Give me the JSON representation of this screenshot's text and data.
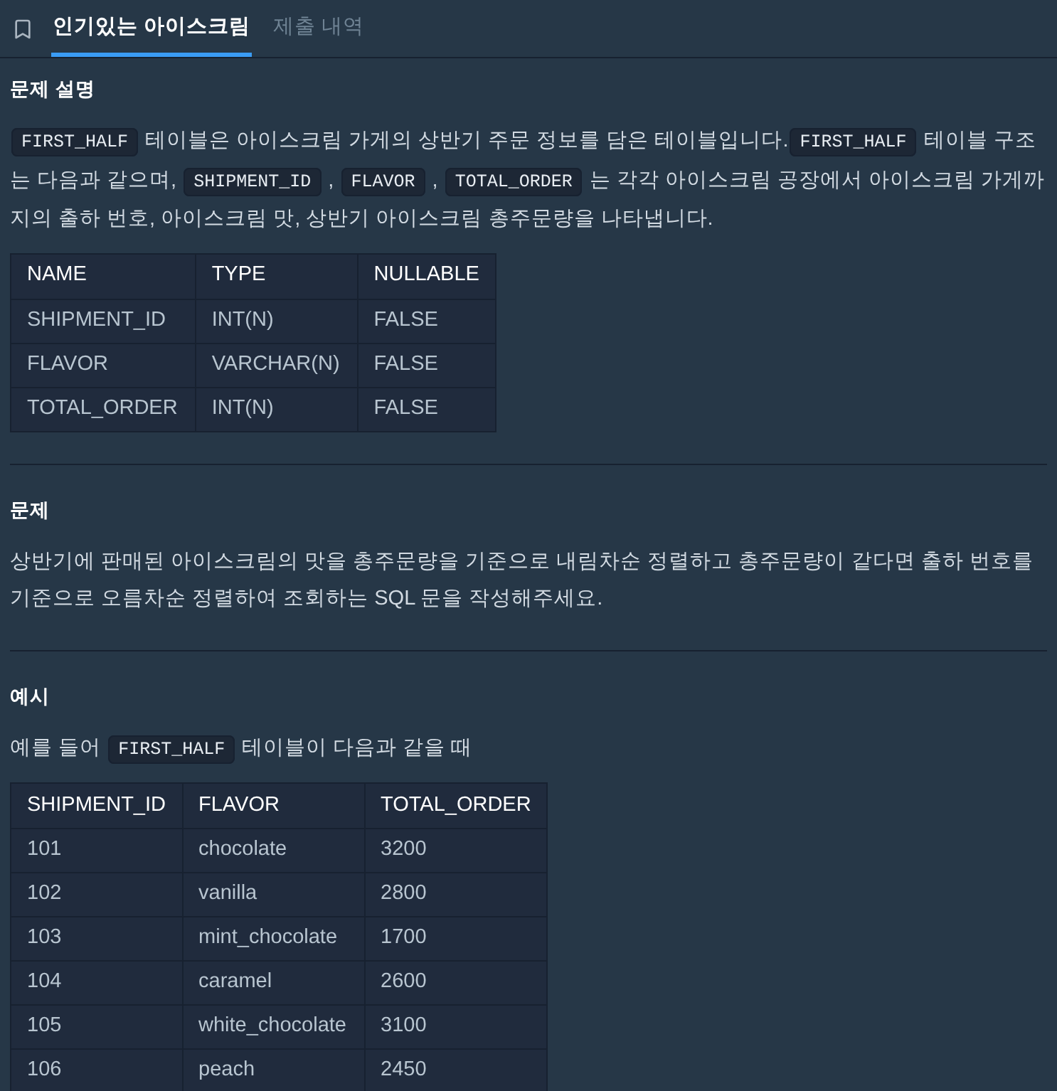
{
  "tabs": [
    {
      "label": "인기있는 아이스크림",
      "selected": true
    },
    {
      "label": "제출 내역",
      "selected": false
    }
  ],
  "sections": [
    {
      "heading": "문제 설명",
      "blocks": [
        {
          "kind": "paragraph",
          "segments": [
            {
              "kind": "code",
              "text": "FIRST_HALF"
            },
            {
              "kind": "text",
              "text": " 테이블은 아이스크림 가게의 상반기 주문 정보를 담은 테이블입니다."
            },
            {
              "kind": "code",
              "text": "FIRST_HALF"
            },
            {
              "kind": "text",
              "text": " 테이블 구조는 다음과 같으며, "
            },
            {
              "kind": "code",
              "text": "SHIPMENT_ID"
            },
            {
              "kind": "text",
              "text": " , "
            },
            {
              "kind": "code",
              "text": "FLAVOR"
            },
            {
              "kind": "text",
              "text": " , "
            },
            {
              "kind": "code",
              "text": "TOTAL_ORDER"
            },
            {
              "kind": "text",
              "text": " 는 각각 아이스크림 공장에서 아이스크림 가게까지의 출하 번호, 아이스크림 맛, 상반기 아이스크림 총주문량을 나타냅니다."
            }
          ]
        },
        {
          "kind": "table",
          "columns": [
            "NAME",
            "TYPE",
            "NULLABLE"
          ],
          "rows": [
            [
              "SHIPMENT_ID",
              "INT(N)",
              "FALSE"
            ],
            [
              "FLAVOR",
              "VARCHAR(N)",
              "FALSE"
            ],
            [
              "TOTAL_ORDER",
              "INT(N)",
              "FALSE"
            ]
          ]
        }
      ]
    },
    {
      "heading": "문제",
      "blocks": [
        {
          "kind": "paragraph",
          "segments": [
            {
              "kind": "text",
              "text": "상반기에 판매된 아이스크림의 맛을 총주문량을 기준으로 내림차순 정렬하고 총주문량이 같다면 출하 번호를 기준으로 오름차순 정렬하여 조회하는 SQL 문을 작성해주세요."
            }
          ]
        }
      ]
    },
    {
      "heading": "예시",
      "blocks": [
        {
          "kind": "paragraph",
          "segments": [
            {
              "kind": "text",
              "text": "예를 들어 "
            },
            {
              "kind": "code",
              "text": "FIRST_HALF"
            },
            {
              "kind": "text",
              "text": " 테이블이 다음과 같을 때"
            }
          ]
        },
        {
          "kind": "table",
          "columns": [
            "SHIPMENT_ID",
            "FLAVOR",
            "TOTAL_ORDER"
          ],
          "rows": [
            [
              "101",
              "chocolate",
              "3200"
            ],
            [
              "102",
              "vanilla",
              "2800"
            ],
            [
              "103",
              "mint_chocolate",
              "1700"
            ],
            [
              "104",
              "caramel",
              "2600"
            ],
            [
              "105",
              "white_chocolate",
              "3100"
            ],
            [
              "106",
              "peach",
              "2450"
            ]
          ]
        }
      ]
    }
  ]
}
